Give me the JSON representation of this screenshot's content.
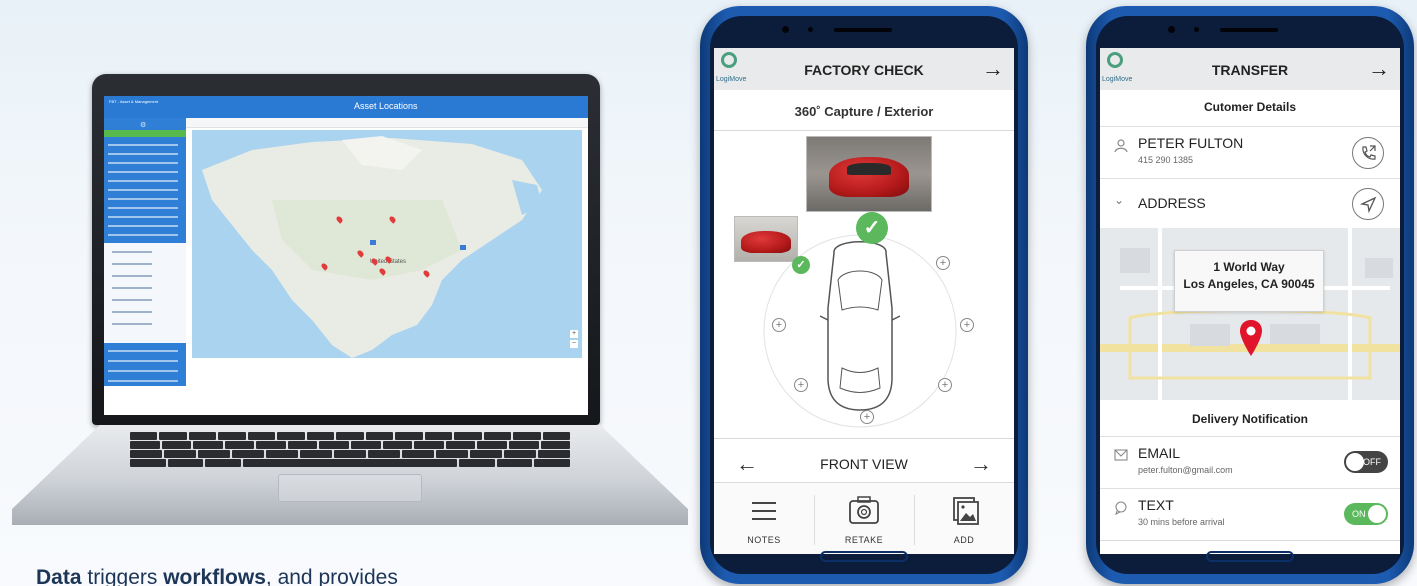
{
  "tagline": {
    "part1": "Data ",
    "part2": "triggers ",
    "part3": "workflows",
    "part4": ", and provides"
  },
  "laptop": {
    "brand": "FBT - Asset & Management",
    "title": "Asset Locations",
    "map_label": "United States",
    "map_zoom_in": "+",
    "map_zoom_out": "−"
  },
  "factory_check": {
    "logo_text": "LogiMove",
    "title": "FACTORY CHECK",
    "header_arrow": "→",
    "subtitle": "360˚ Capture / Exterior",
    "view_prev": "←",
    "view_label": "FRONT VIEW",
    "view_next": "→",
    "buttons": [
      {
        "label": "NOTES",
        "icon": "menu-icon"
      },
      {
        "label": "RETAKE",
        "icon": "camera-icon"
      },
      {
        "label": "ADD",
        "icon": "image-icon"
      }
    ]
  },
  "transfer": {
    "logo_text": "LogiMove",
    "title": "TRANSFER",
    "header_arrow": "→",
    "customer_section": "Cutomer Details",
    "customer_name": "PETER FULTON",
    "customer_phone": "415 290 1385",
    "address_label": "ADDRESS",
    "address_line1": "1 World Way",
    "address_line2": "Los Angeles, CA 90045",
    "delivery_section": "Delivery Notification",
    "email_label": "EMAIL",
    "email_value": "peter.fulton@gmail.com",
    "email_toggle": "OFF",
    "email_toggle_on": false,
    "text_label": "TEXT",
    "text_value": "30 mins before arrival",
    "text_toggle": "ON",
    "text_toggle_on": true
  }
}
